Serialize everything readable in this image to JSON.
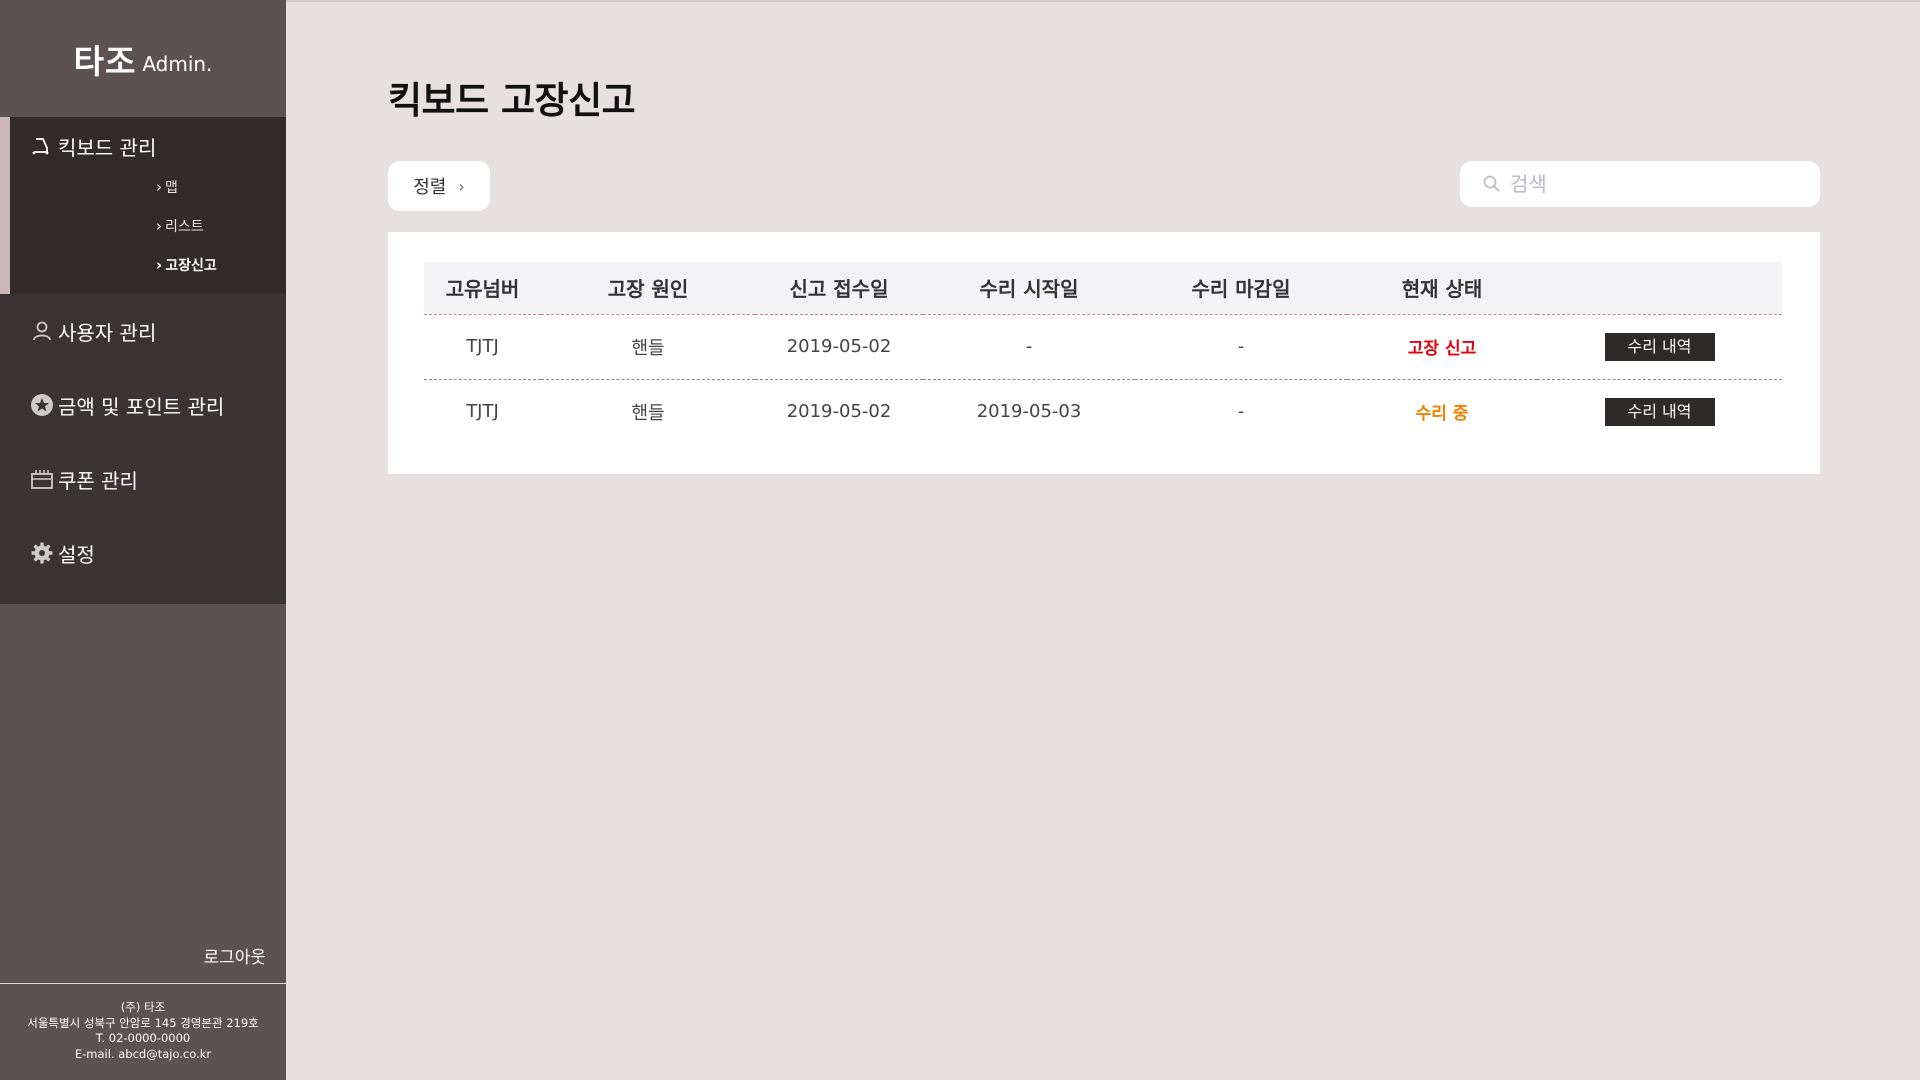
{
  "brand": {
    "main": "타조",
    "sub": "Admin."
  },
  "sidebar": {
    "groups": [
      {
        "label": "킥보드 관리",
        "icon": "kickboard-icon",
        "children": [
          {
            "label": "맵"
          },
          {
            "label": "리스트"
          },
          {
            "label": "고장신고"
          }
        ]
      },
      {
        "label": "사용자 관리",
        "icon": "user-icon"
      },
      {
        "label": "금액 및 포인트 관리",
        "icon": "star-icon"
      },
      {
        "label": "쿠폰 관리",
        "icon": "coupon-icon"
      },
      {
        "label": "설정",
        "icon": "gear-icon"
      }
    ],
    "logout": "로그아웃",
    "footer": {
      "company": "(주) 타조",
      "address": "서울특별시 성북구 안암로 145 경영본관 219호",
      "phone": "T. 02-0000-0000",
      "email": "E-mail. abcd@tajo.co.kr"
    }
  },
  "main": {
    "title": "킥보드 고장신고",
    "sort_label": "정렬",
    "search_placeholder": "검색",
    "table": {
      "headers": [
        "고유넘버",
        "고장 원인",
        "신고 접수일",
        "수리 시작일",
        "수리 마감일",
        "현재 상태",
        ""
      ],
      "rows": [
        {
          "id": "TJTJ",
          "cause": "핸들",
          "reported": "2019-05-02",
          "start": "-",
          "end": "-",
          "status": "고장 신고",
          "action": "수리 내역"
        },
        {
          "id": "TJTJ",
          "cause": "핸들",
          "reported": "2019-05-02",
          "start": "2019-05-03",
          "end": "-",
          "status": "수리 중",
          "action": "수리 내역"
        }
      ]
    }
  },
  "colors": {
    "sidebar_bg": "#5c5252",
    "nav_bg": "#3a3434",
    "active_accent": "#cbb6b8",
    "page_bg": "#e6e0e1",
    "status_report": "#e4000f",
    "status_repair": "#f08200",
    "button_dark": "#2e2a2a"
  }
}
